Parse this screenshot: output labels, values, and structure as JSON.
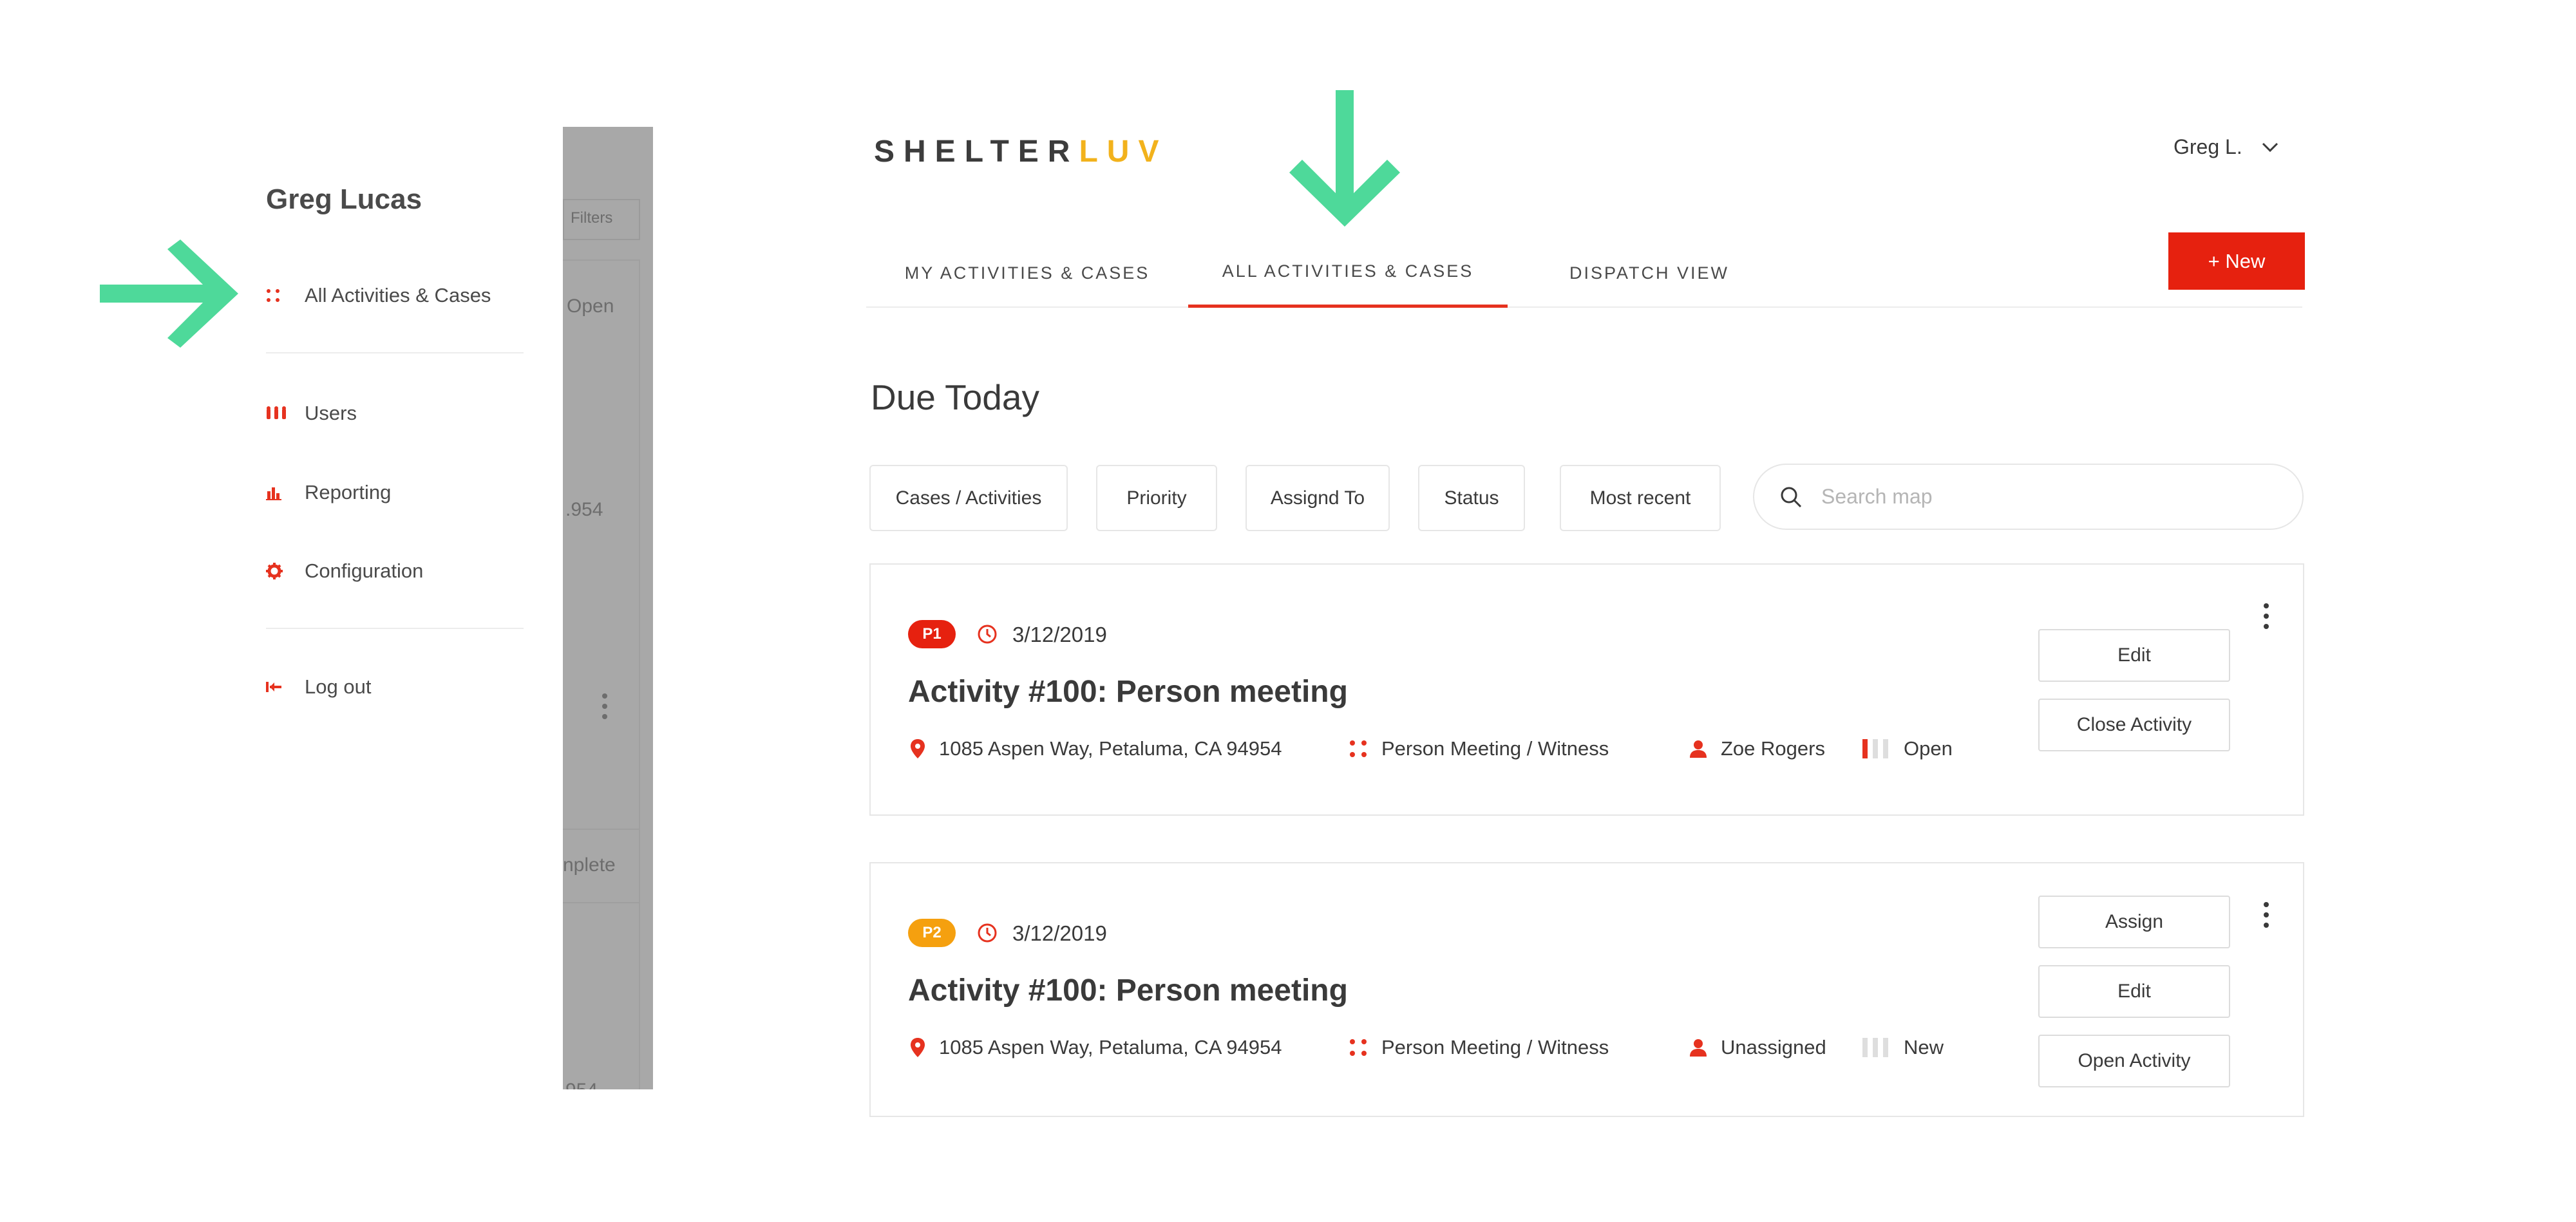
{
  "drawer": {
    "user_name": "Greg Lucas",
    "items": [
      {
        "label": "All Activities & Cases",
        "icon": "grid-dots-icon"
      },
      {
        "label": "Users",
        "icon": "users-icon"
      },
      {
        "label": "Reporting",
        "icon": "bar-chart-icon"
      },
      {
        "label": "Configuration",
        "icon": "gear-icon"
      },
      {
        "label": "Log out",
        "icon": "logout-icon"
      }
    ]
  },
  "overlay": {
    "filters_label": "Filters",
    "open_label": "Open",
    "zip_fragment": ".954",
    "complete_fragment": "nplete",
    "bottom_fragment": "954"
  },
  "brand": {
    "part1": "SHELTER",
    "part2": "LUV",
    "accent_color": "#f2b21c"
  },
  "user_menu": {
    "name": "Greg L."
  },
  "tabs": [
    {
      "label": "MY ACTIVITIES & CASES"
    },
    {
      "label": "ALL ACTIVITIES & CASES",
      "active": true
    },
    {
      "label": "DISPATCH VIEW"
    }
  ],
  "new_button": {
    "label": "+ New",
    "color": "#e6210f"
  },
  "section_title": "Due Today",
  "filters": [
    "Cases / Activities",
    "Priority",
    "Assignd To",
    "Status",
    "Most recent"
  ],
  "search": {
    "placeholder": "Search map"
  },
  "cards": [
    {
      "priority": "P1",
      "priority_color": "#e6210f",
      "date": "3/12/2019",
      "title": "Activity #100: Person meeting",
      "address": "1085 Aspen Way, Petaluma, CA 94954",
      "type": "Person Meeting / Witness",
      "assignee": "Zoe Rogers",
      "status": "Open",
      "actions": [
        "Edit",
        "Close Activity"
      ]
    },
    {
      "priority": "P2",
      "priority_color": "#f5a00f",
      "date": "3/12/2019",
      "title": "Activity #100: Person meeting",
      "address": "1085 Aspen Way, Petaluma, CA 94954",
      "type": "Person Meeting / Witness",
      "assignee": "Unassigned",
      "status": "New",
      "actions": [
        "Assign",
        "Edit",
        "Open Activity"
      ]
    }
  ],
  "colors": {
    "accent_red": "#e6321f",
    "annotation_green": "#4ed99a"
  }
}
